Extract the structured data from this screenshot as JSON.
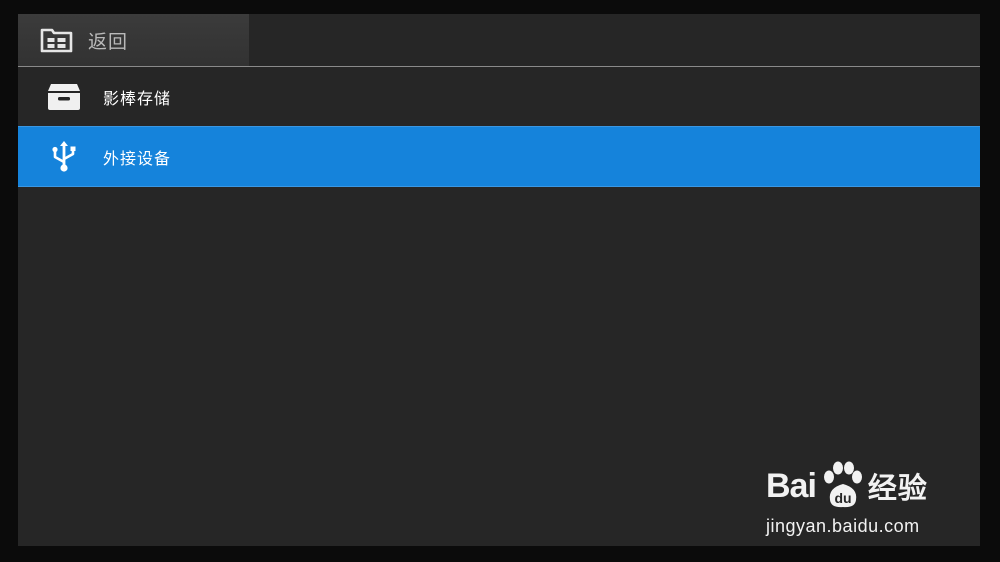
{
  "header": {
    "back_label": "返回",
    "back_icon": "folder-back-icon"
  },
  "list": {
    "items": [
      {
        "label": "影棒存储",
        "icon": "storage-box-icon",
        "selected": false
      },
      {
        "label": "外接设备",
        "icon": "usb-icon",
        "selected": true
      }
    ]
  },
  "colors": {
    "background": "#262626",
    "selection": "#1583db",
    "back_tab": "#363636",
    "text": "#ffffff"
  },
  "watermark": {
    "brand_bai": "Bai",
    "brand_jingyan": "经验",
    "url": "jingyan.baidu.com"
  }
}
